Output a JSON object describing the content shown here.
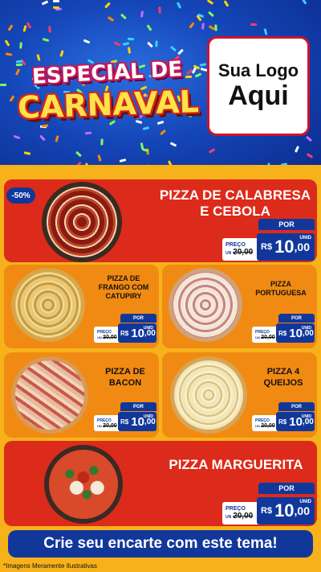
{
  "header": {
    "title_top": "ESPECIAL DE",
    "title_bottom": "CARNAVAL",
    "logo_line1": "Sua Logo",
    "logo_line2": "Aqui"
  },
  "colors": {
    "red_card": "#dc2b1a",
    "orange_card": "#f18a12",
    "panel": "#f7b21b",
    "blue": "#12379b"
  },
  "featured": {
    "badge": "-50%",
    "name_line1": "PIZZA DE CALABRESA",
    "name_line2": "E CEBOLA",
    "por": "POR",
    "preco_label": "PREÇO",
    "unid_small": "UN",
    "old_price": "20,00",
    "currency": "R$",
    "price_int": "10",
    "price_dec": ",00",
    "unit": "UNID"
  },
  "grid": [
    {
      "name_lines": [
        "PIZZA DE",
        "FRANGO COM",
        "CATUPIRY"
      ],
      "por": "POR",
      "preco_label": "PREÇO",
      "unid_small": "UN",
      "old_price": "20,00",
      "currency": "R$",
      "price_int": "10",
      "price_dec": ",00",
      "unit": "UNID"
    },
    {
      "name_lines": [
        "PIZZA",
        "PORTUGUESA"
      ],
      "por": "POR",
      "preco_label": "PREÇO",
      "unid_small": "UN",
      "old_price": "20,00",
      "currency": "R$",
      "price_int": "10",
      "price_dec": ",00",
      "unit": "UNID"
    },
    {
      "name_lines": [
        "PIZZA DE",
        "BACON"
      ],
      "por": "POR",
      "preco_label": "PREÇO",
      "unid_small": "UN",
      "old_price": "20,00",
      "currency": "R$",
      "price_int": "10",
      "price_dec": ",00",
      "unit": "UNID"
    },
    {
      "name_lines": [
        "PIZZA 4",
        "QUEIJOS"
      ],
      "por": "POR",
      "preco_label": "PREÇO",
      "unid_small": "UN",
      "old_price": "20,00",
      "currency": "R$",
      "price_int": "10",
      "price_dec": ",00",
      "unit": "UNID"
    }
  ],
  "bottom": {
    "name": "PIZZA MARGUERITA",
    "por": "POR",
    "preco_label": "PREÇO",
    "unid_small": "UN",
    "old_price": "20,00",
    "currency": "R$",
    "price_int": "10",
    "price_dec": ",00",
    "unit": "UNID"
  },
  "cta": "Crie seu encarte com este tema!",
  "footnote": "*Imagens Meramente Ilustrativas"
}
